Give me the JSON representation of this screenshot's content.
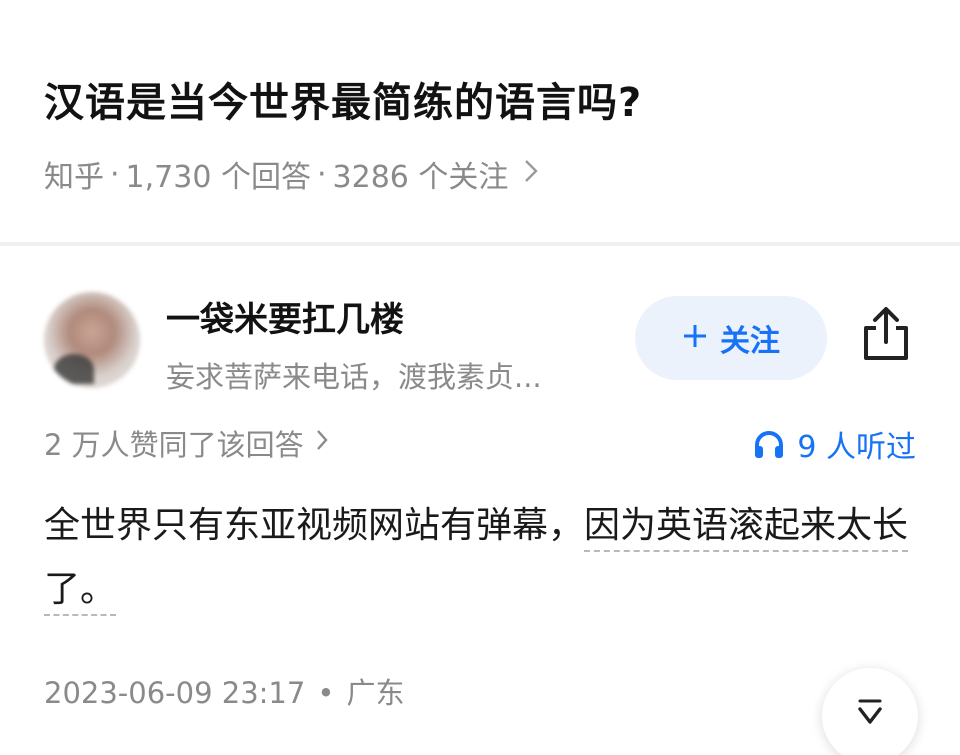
{
  "question": {
    "title": "汉语是当今世界最简练的语言吗?",
    "source": "知乎",
    "answers": "1,730 个回答",
    "followers": "3286 个关注"
  },
  "author": {
    "name": "一袋米要扛几楼",
    "bio": "妄求菩萨来电话，渡我素贞...",
    "follow_label": "关注"
  },
  "answer": {
    "approve_text": "2 万人赞同了该回答",
    "listen_text": "9 人听过",
    "content_part1": "全世界只有东亚视频网站有弹幕，",
    "content_part2": "因为英语滚起来太长了。",
    "date": "2023-06-09 23:17",
    "location": "广东"
  },
  "colors": {
    "accent": "#1772f6",
    "follow_bg": "#ebf2fc",
    "muted_text": "#8a8a8a"
  },
  "icons": [
    "chevron-right-icon",
    "plus-icon",
    "share-icon",
    "headphones-icon",
    "chevron-down-icon"
  ]
}
